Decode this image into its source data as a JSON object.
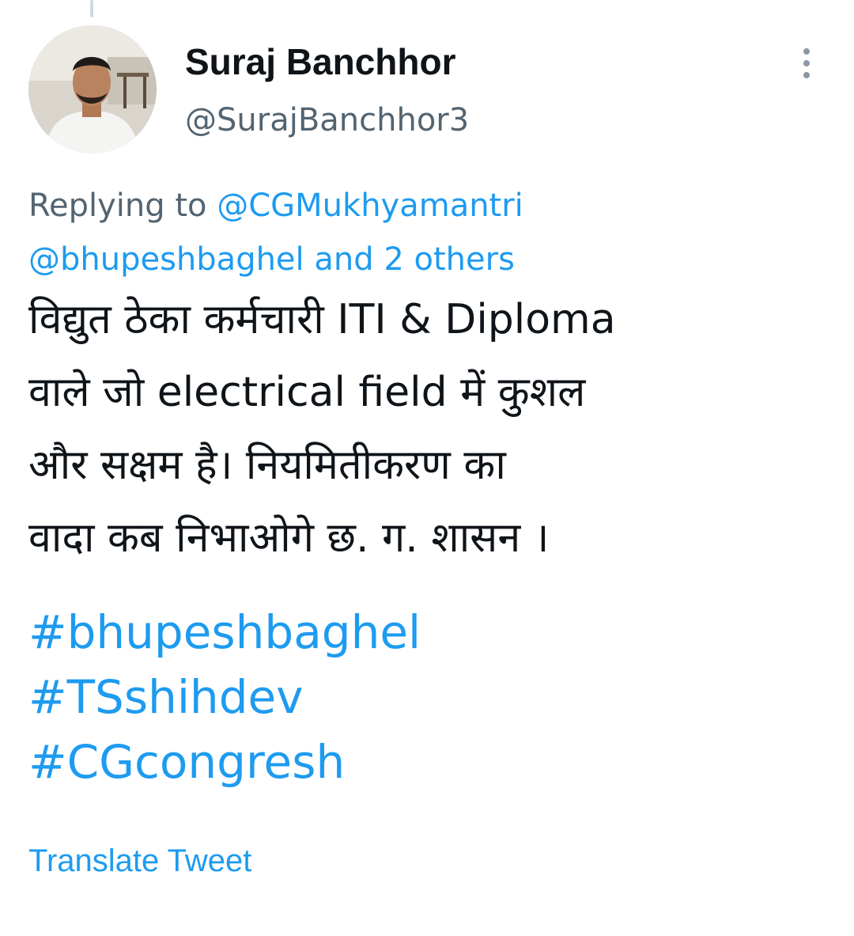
{
  "author": {
    "display_name": "Suraj Banchhor",
    "handle": "@SurajBanchhor3",
    "avatar_icon": "profile-photo"
  },
  "menu": {
    "icon": "more-vertical-icon"
  },
  "reply": {
    "prefix": "Replying to ",
    "mention_1": "@CGMukhyamantri",
    "mention_2": "@bhupeshbaghel",
    "others": "and 2 others"
  },
  "tweet": {
    "lines": [
      "विद्युत ठेका कर्मचारी ITI & Diploma",
      "वाले जो electrical field में कुशल",
      "और सक्षम है। नियमितीकरण का",
      "वादा कब निभाओगे छ. ग. शासन ।"
    ],
    "hashtags": [
      "#bhupeshbaghel",
      "#TSshihdev",
      "#CGcongresh"
    ]
  },
  "translate_label": "Translate Tweet",
  "colors": {
    "link": "#1d9bf0",
    "text": "#0f1419",
    "secondary": "#536471"
  }
}
